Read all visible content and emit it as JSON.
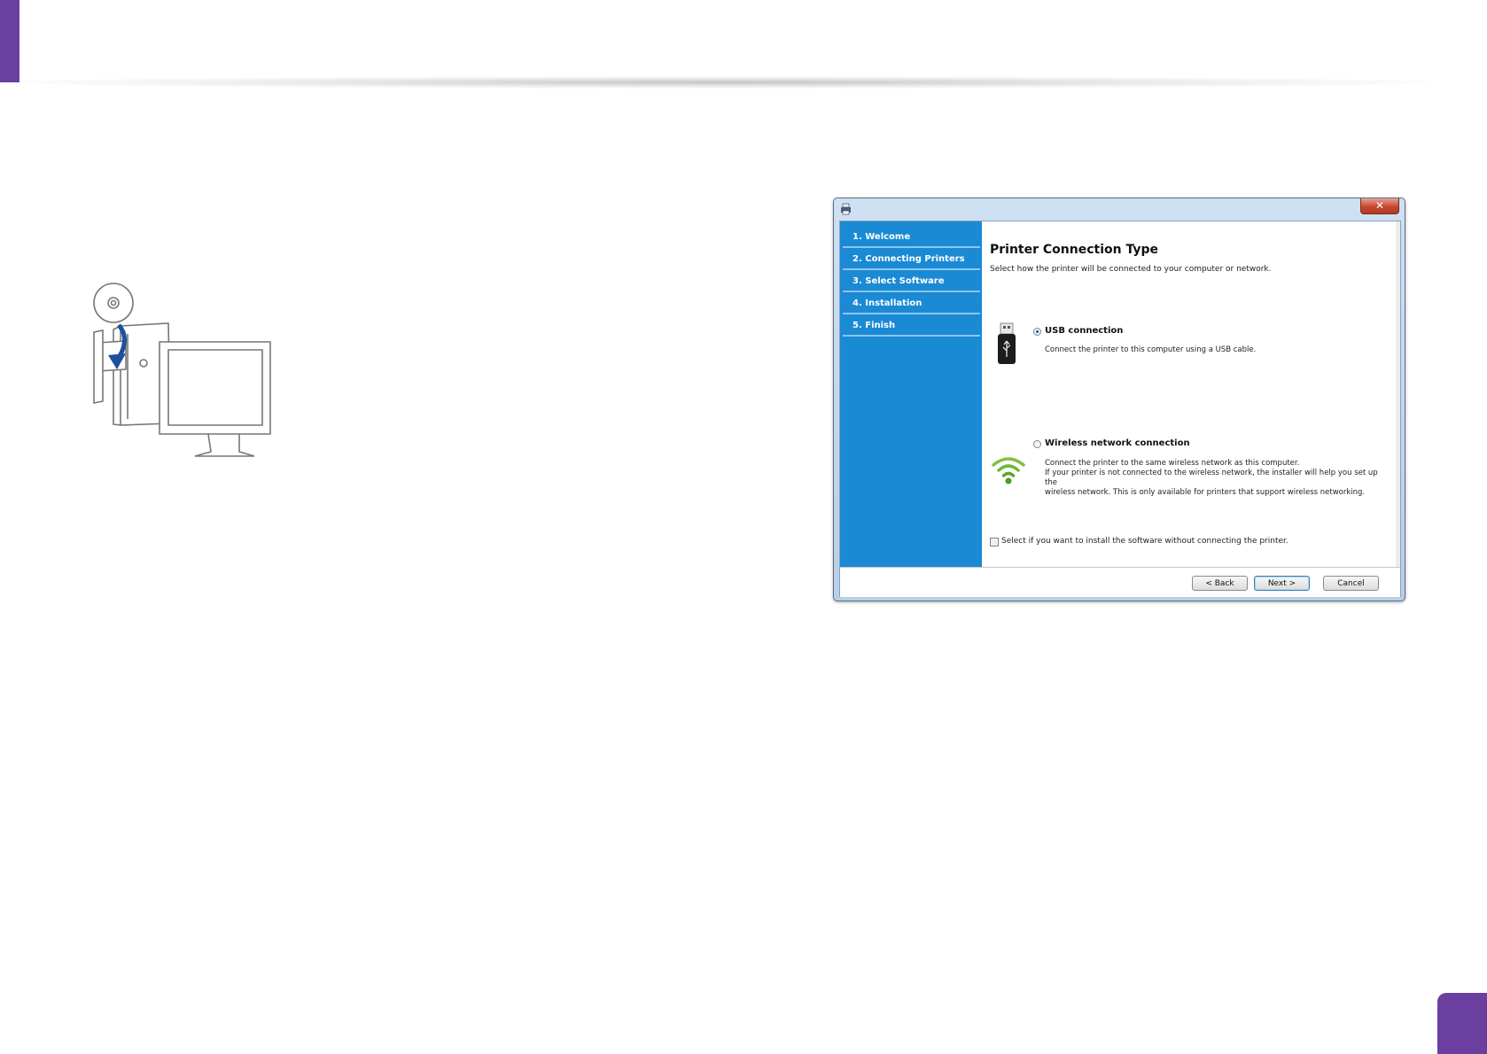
{
  "window": {
    "close_label": "✕"
  },
  "sidebar": {
    "steps": [
      {
        "label": "1. Welcome"
      },
      {
        "label": "2. Connecting Printers"
      },
      {
        "label": "3. Select Software"
      },
      {
        "label": "4. Installation"
      },
      {
        "label": "5. Finish"
      }
    ]
  },
  "content": {
    "title": "Printer Connection Type",
    "subtitle": "Select how the printer will be connected to your computer or network.",
    "options": [
      {
        "label": "USB connection",
        "selected": true,
        "icon": "usb-icon",
        "description": [
          "Connect the printer to this computer using a USB cable."
        ]
      },
      {
        "label": "Wireless network connection",
        "selected": false,
        "icon": "wifi-icon",
        "description": [
          "Connect the printer to the same wireless network as this computer.",
          "If your printer is not connected to the wireless network, the installer will help you set up the",
          "wireless network. This is only available for printers that support wireless networking."
        ]
      }
    ],
    "no_printer_checkbox": "Select if you want to install the software without connecting the printer."
  },
  "buttons": {
    "back": "< Back",
    "next": "Next >",
    "cancel": "Cancel"
  },
  "colors": {
    "accent_purple": "#6b3fa0",
    "sidebar_blue": "#1a8ad4"
  }
}
